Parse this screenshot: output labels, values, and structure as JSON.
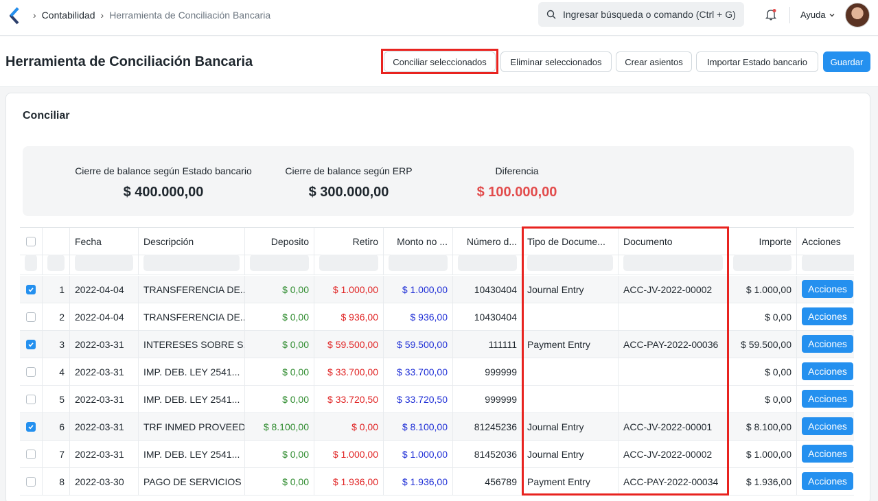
{
  "navbar": {
    "breadcrumbs": [
      "Contabilidad",
      "Herramienta de Conciliación Bancaria"
    ],
    "search_placeholder": "Ingresar búsqueda o comando (Ctrl + G)",
    "help_label": "Ayuda"
  },
  "page": {
    "title": "Herramienta de Conciliación Bancaria",
    "actions": {
      "reconcile": "Conciliar seleccionados",
      "delete": "Eliminar seleccionados",
      "create_entries": "Crear asientos",
      "import": "Importar Estado bancario",
      "save": "Guardar"
    }
  },
  "card": {
    "title": "Conciliar",
    "summary": [
      {
        "label": "Cierre de balance según Estado bancario",
        "value": "$ 400.000,00"
      },
      {
        "label": "Cierre de balance según ERP",
        "value": "$ 300.000,00"
      },
      {
        "label": "Diferencia",
        "value": "$ 100.000,00"
      }
    ]
  },
  "table": {
    "columns": [
      "Fecha",
      "Descripción",
      "Deposito",
      "Retiro",
      "Monto no ...",
      "Número d...",
      "Tipo de Docume...",
      "Documento",
      "Importe",
      "Acciones"
    ],
    "action_label": "Acciones",
    "rows": [
      {
        "num": "1",
        "checked": true,
        "fecha": "2022-04-04",
        "desc": "TRANSFERENCIA DE...",
        "dep": "$ 0,00",
        "ret": "$ 1.000,00",
        "monto": "$ 1.000,00",
        "numero": "10430404",
        "tipo": "Journal Entry",
        "doc": "ACC-JV-2022-00002",
        "importe": "$ 1.000,00"
      },
      {
        "num": "2",
        "checked": false,
        "fecha": "2022-04-04",
        "desc": "TRANSFERENCIA DE...",
        "dep": "$ 0,00",
        "ret": "$ 936,00",
        "monto": "$ 936,00",
        "numero": "10430404",
        "tipo": "",
        "doc": "",
        "importe": "$ 0,00"
      },
      {
        "num": "3",
        "checked": true,
        "fecha": "2022-03-31",
        "desc": "INTERESES SOBRE S...",
        "dep": "$ 0,00",
        "ret": "$ 59.500,00",
        "monto": "$ 59.500,00",
        "numero": "111111",
        "tipo": "Payment Entry",
        "doc": "ACC-PAY-2022-00036",
        "importe": "$ 59.500,00"
      },
      {
        "num": "4",
        "checked": false,
        "fecha": "2022-03-31",
        "desc": "IMP. DEB. LEY 2541...",
        "dep": "$ 0,00",
        "ret": "$ 33.700,00",
        "monto": "$ 33.700,00",
        "numero": "999999",
        "tipo": "",
        "doc": "",
        "importe": "$ 0,00"
      },
      {
        "num": "5",
        "checked": false,
        "fecha": "2022-03-31",
        "desc": "IMP. DEB. LEY 2541...",
        "dep": "$ 0,00",
        "ret": "$ 33.720,50",
        "monto": "$ 33.720,50",
        "numero": "999999",
        "tipo": "",
        "doc": "",
        "importe": "$ 0,00"
      },
      {
        "num": "6",
        "checked": true,
        "fecha": "2022-03-31",
        "desc": "TRF INMED PROVEED",
        "dep": "$ 8.100,00",
        "ret": "$ 0,00",
        "monto": "$ 8.100,00",
        "numero": "81245236",
        "tipo": "Journal Entry",
        "doc": "ACC-JV-2022-00001",
        "importe": "$ 8.100,00"
      },
      {
        "num": "7",
        "checked": false,
        "fecha": "2022-03-31",
        "desc": "IMP. DEB. LEY 2541...",
        "dep": "$ 0,00",
        "ret": "$ 1.000,00",
        "monto": "$ 1.000,00",
        "numero": "81452036",
        "tipo": "Journal Entry",
        "doc": "ACC-JV-2022-00002",
        "importe": "$ 1.000,00"
      },
      {
        "num": "8",
        "checked": false,
        "fecha": "2022-03-30",
        "desc": "PAGO DE SERVICIOS",
        "dep": "$ 0,00",
        "ret": "$ 1.936,00",
        "monto": "$ 1.936,00",
        "numero": "456789",
        "tipo": "Payment Entry",
        "doc": "ACC-PAY-2022-00034",
        "importe": "$ 1.936,00"
      }
    ]
  }
}
